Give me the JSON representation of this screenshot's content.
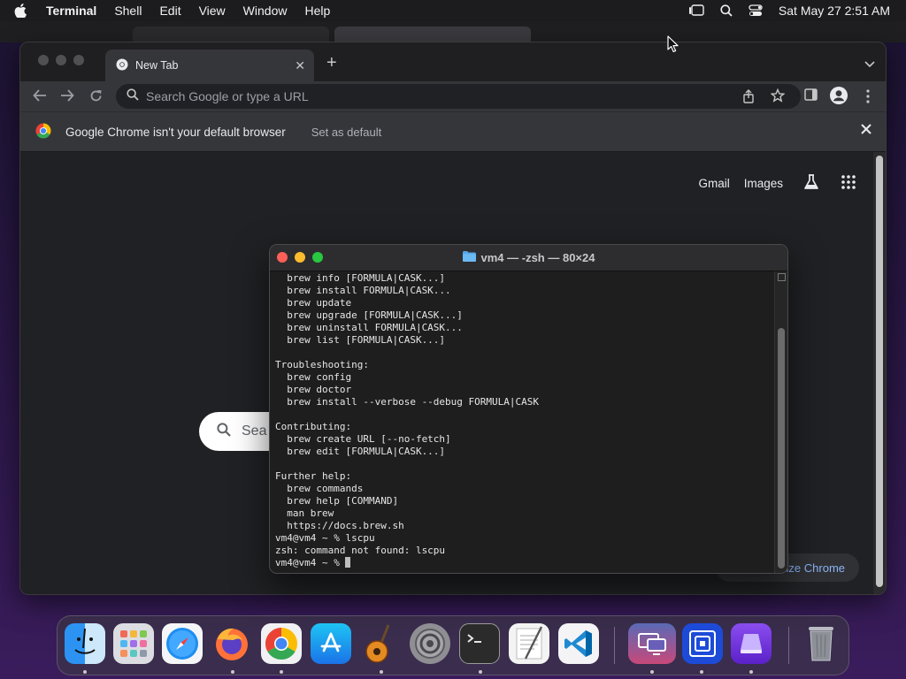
{
  "menubar": {
    "app_name": "Terminal",
    "items": [
      "Shell",
      "Edit",
      "View",
      "Window",
      "Help"
    ],
    "clock": "Sat May 27  2:51 AM"
  },
  "chrome": {
    "tab_title": "New Tab",
    "omnibox_placeholder": "Search Google or type a URL",
    "infobar_message": "Google Chrome isn't your default browser",
    "infobar_action": "Set as default",
    "links": {
      "gmail": "Gmail",
      "images": "Images"
    },
    "search_placeholder": "Sea",
    "customize_label": "ize Chrome"
  },
  "terminal": {
    "title": "vm4 — -zsh — 80×24",
    "lines": [
      "  brew info [FORMULA|CASK...]",
      "  brew install FORMULA|CASK...",
      "  brew update",
      "  brew upgrade [FORMULA|CASK...]",
      "  brew uninstall FORMULA|CASK...",
      "  brew list [FORMULA|CASK...]",
      "",
      "Troubleshooting:",
      "  brew config",
      "  brew doctor",
      "  brew install --verbose --debug FORMULA|CASK",
      "",
      "Contributing:",
      "  brew create URL [--no-fetch]",
      "  brew edit [FORMULA|CASK...]",
      "",
      "Further help:",
      "  brew commands",
      "  brew help [COMMAND]",
      "  man brew",
      "  https://docs.brew.sh",
      "vm4@vm4 ~ % lscpu",
      "zsh: command not found: lscpu"
    ],
    "prompt": "vm4@vm4 ~ % "
  },
  "dock": {
    "apps": [
      "finder",
      "launchpad",
      "safari",
      "firefox",
      "chrome",
      "app-store",
      "garageband",
      "system-settings",
      "terminal",
      "textedit",
      "vscode",
      "screen-sharing",
      "utm",
      "vm-app",
      "trash"
    ]
  },
  "colors": {
    "chrome_bg": "#202124",
    "terminal_bg": "#1e1e1e",
    "link_blue": "#8ab4f8"
  }
}
